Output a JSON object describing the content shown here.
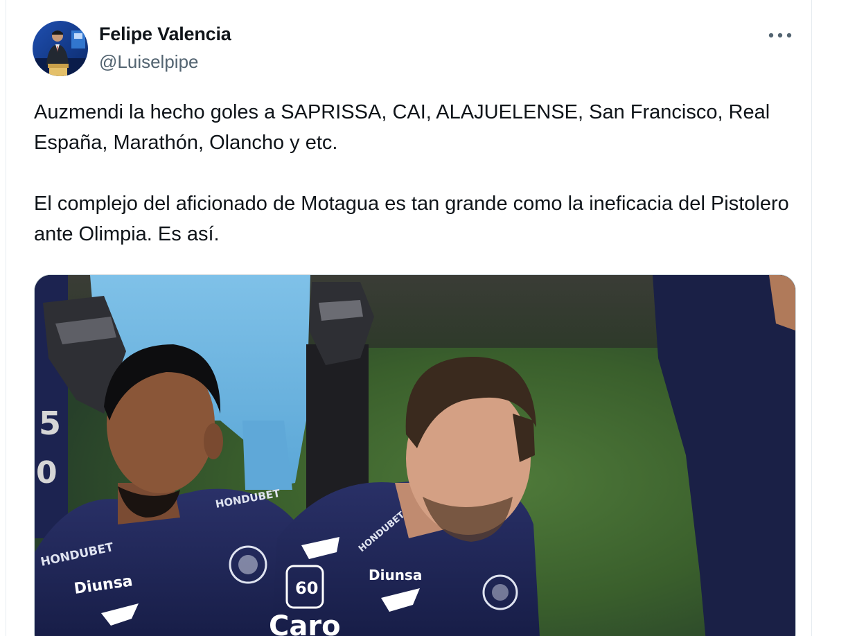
{
  "author": {
    "name": "Felipe Valencia",
    "handle": "@Luiselpipe"
  },
  "tweet": {
    "paragraphs": [
      "Auzmendi la hecho goles a SAPRISSA, CAI, ALAJUELENSE, San Francisco, Real España, Marathón, Olancho y etc.",
      "El complejo del aficionado de Motagua es tan grande como la ineficacia del Pistolero ante Olimpia. Es así."
    ]
  },
  "media": {
    "sponsor_left": "HONDUBET",
    "brand_left": "Diunsa",
    "sponsor_right": "Diunsa",
    "badge_number": "60",
    "partial_text": "Caro"
  },
  "icons": {
    "more": "more-horizontal-icon"
  },
  "colors": {
    "text": "#0f1419",
    "secondary": "#536471",
    "jersey": "#1d2553"
  }
}
